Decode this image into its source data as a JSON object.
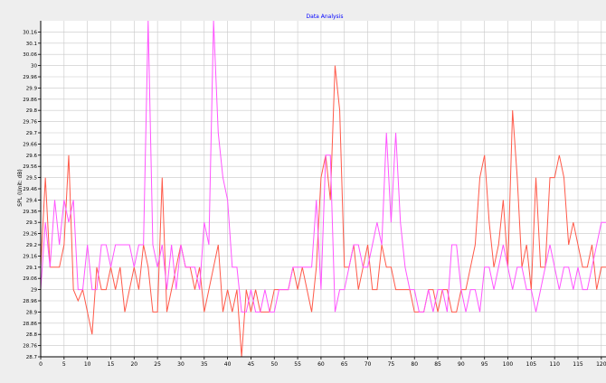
{
  "chart_data": {
    "type": "line",
    "title": "Data Analysis",
    "ylabel": "SPL (Unit: dB)",
    "xlabel": "",
    "xlim": [
      0,
      121
    ],
    "ylim": [
      28.7,
      30.2
    ],
    "grid": true,
    "legend": "none",
    "x_ticks": [
      0,
      5,
      10,
      15,
      20,
      25,
      30,
      35,
      40,
      45,
      50,
      55,
      60,
      65,
      70,
      75,
      80,
      85,
      90,
      95,
      100,
      105,
      110,
      115,
      120
    ],
    "y_ticks": [
      28.7,
      28.75,
      28.8,
      28.85,
      28.9,
      28.95,
      29,
      29.05,
      29.1,
      29.15,
      29.2,
      29.25,
      29.3,
      29.35,
      29.4,
      29.45,
      29.5,
      29.55,
      29.6,
      29.65,
      29.7,
      29.75,
      29.8,
      29.85,
      29.9,
      29.95,
      30,
      30.05,
      30.1,
      30.15
    ],
    "y_tick_labels": [
      "28.7",
      "28.76",
      "28.8",
      "28.86",
      "28.9",
      "28.96",
      "29",
      "29.06",
      "29.1",
      "29.16",
      "29.2",
      "29.26",
      "29.3",
      "29.36",
      "29.4",
      "29.46",
      "29.5",
      "29.56",
      "29.6",
      "29.66",
      "29.7",
      "29.76",
      "29.8",
      "29.86",
      "29.9",
      "29.96",
      "30",
      "30.06",
      "30.1",
      "30.16"
    ],
    "series": [
      {
        "color": "#ff5a4a",
        "values": [
          29.1,
          29.5,
          29.1,
          29.1,
          29.1,
          29.2,
          29.6,
          29.0,
          28.95,
          29.0,
          28.9,
          28.8,
          29.1,
          29.0,
          29.0,
          29.1,
          29.0,
          29.1,
          28.9,
          29.0,
          29.1,
          29.0,
          29.2,
          29.1,
          28.9,
          28.9,
          29.5,
          28.9,
          29.0,
          29.1,
          29.2,
          29.1,
          29.1,
          29.0,
          29.1,
          28.9,
          29.0,
          29.1,
          29.2,
          28.9,
          29.0,
          28.9,
          29.0,
          28.7,
          29.0,
          28.9,
          29.0,
          28.9,
          28.9,
          28.9,
          29.0,
          29.0,
          29.0,
          29.0,
          29.1,
          29.0,
          29.1,
          29.0,
          28.9,
          29.1,
          29.5,
          29.6,
          29.4,
          30.0,
          29.8,
          29.1,
          29.1,
          29.2,
          29.0,
          29.1,
          29.2,
          29.0,
          29.0,
          29.2,
          29.1,
          29.1,
          29.0,
          29.0,
          29.0,
          29.0,
          28.9,
          28.9,
          28.9,
          29.0,
          29.0,
          28.9,
          29.0,
          29.0,
          28.9,
          28.9,
          29.0,
          29.0,
          29.1,
          29.2,
          29.5,
          29.6,
          29.3,
          29.1,
          29.2,
          29.4,
          29.1,
          29.8,
          29.5,
          29.1,
          29.2,
          29.0,
          29.5,
          29.1,
          29.1,
          29.5,
          29.5,
          29.6,
          29.5,
          29.2,
          29.3,
          29.2,
          29.1,
          29.1,
          29.2,
          29.0,
          29.1,
          29.1,
          29.1,
          29.0,
          29.1,
          29.1,
          29.0
        ]
      },
      {
        "color": "#ff55ff",
        "values": [
          29.0,
          29.3,
          29.1,
          29.4,
          29.2,
          29.4,
          29.3,
          29.4,
          29.0,
          29.0,
          29.2,
          29.0,
          29.0,
          29.2,
          29.2,
          29.1,
          29.2,
          29.2,
          29.2,
          29.2,
          29.1,
          29.2,
          29.2,
          30.2,
          29.2,
          29.1,
          29.2,
          29.0,
          29.2,
          29.0,
          29.2,
          29.1,
          29.1,
          29.1,
          29.0,
          29.3,
          29.2,
          30.2,
          29.7,
          29.5,
          29.4,
          29.1,
          29.1,
          28.9,
          28.9,
          29.0,
          28.9,
          28.9,
          29.0,
          28.9,
          28.9,
          29.0,
          29.0,
          29.0,
          29.1,
          29.1,
          29.1,
          29.1,
          29.1,
          29.4,
          29.0,
          29.6,
          29.6,
          28.9,
          29.0,
          29.0,
          29.1,
          29.2,
          29.2,
          29.1,
          29.1,
          29.2,
          29.3,
          29.2,
          29.7,
          29.3,
          29.7,
          29.3,
          29.1,
          29.0,
          29.0,
          28.9,
          28.9,
          29.0,
          28.9,
          29.0,
          29.0,
          28.9,
          29.2,
          29.2,
          29.0,
          28.9,
          29.0,
          29.0,
          28.9,
          29.1,
          29.1,
          29.0,
          29.1,
          29.2,
          29.1,
          29.0,
          29.1,
          29.1,
          29.0,
          29.0,
          28.9,
          29.0,
          29.1,
          29.2,
          29.1,
          29.0,
          29.1,
          29.1,
          29.0,
          29.1,
          29.0,
          29.0,
          29.1,
          29.2,
          29.3,
          29.3
        ]
      }
    ]
  },
  "colors": {
    "plot_bg": "#ffffff",
    "page_bg": "#eeeeee",
    "grid": "#c8c8c8",
    "axis": "#000000",
    "title": "#0000ff"
  }
}
